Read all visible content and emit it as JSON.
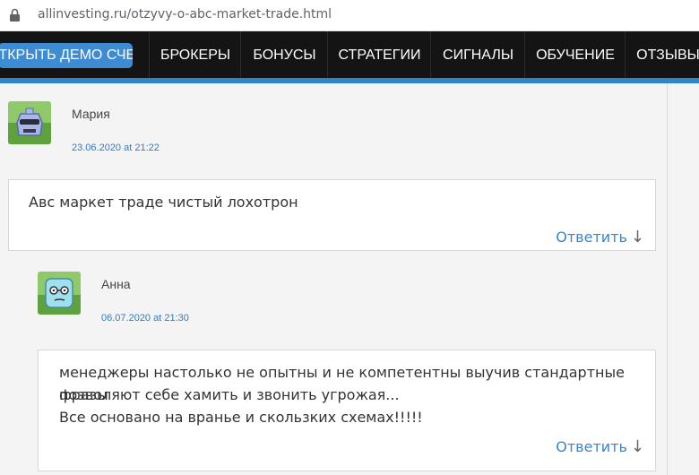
{
  "browser": {
    "url": "allinvesting.ru/otzyvy-o-abc-market-trade.html"
  },
  "nav": {
    "demo_label": "ОТКРЫТЬ ДЕМО СЧЕТ",
    "items": [
      "БРОКЕРЫ",
      "БОНУСЫ",
      "СТРАТЕГИИ",
      "СИГНАЛЫ",
      "ОБУЧЕНИЕ",
      "ОТЗЫВЫ"
    ]
  },
  "comments": [
    {
      "author": "Мария",
      "date": "23.06.2020 at 21:22",
      "lines": [
        "Авс маркет траде чистый лохотрон"
      ],
      "reply": "Ответить",
      "reply_arrow": "↓"
    },
    {
      "author": "Анна",
      "date": "06.07.2020 at 21:30",
      "lines": [
        "менеджеры настолько не опытны и не компетентны выучив стандартные фразы",
        "позволяют себе хамить и звонить угрожая...",
        "Все основано на вранье и скользких схемах!!!!!"
      ],
      "reply": "Ответить",
      "reply_arrow": "↓"
    }
  ],
  "colors": {
    "nav_bg": "#141414",
    "accent": "#2e86c9",
    "link": "#3586cc"
  }
}
